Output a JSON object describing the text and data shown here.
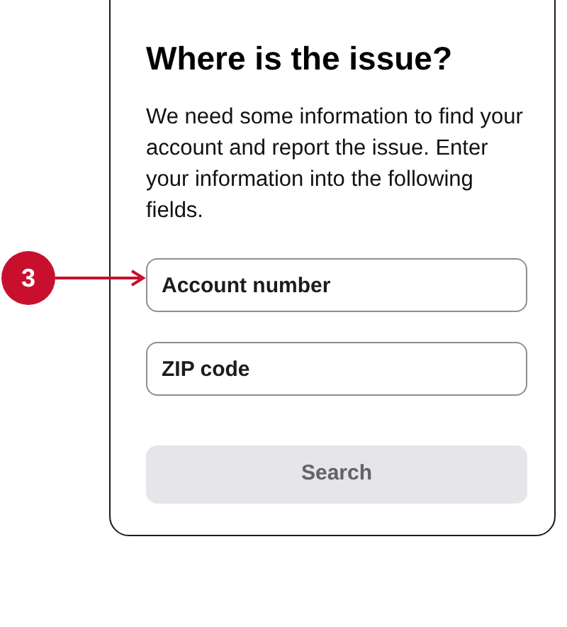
{
  "card": {
    "title": "Where is the issue?",
    "description": "We need some information to find your account and report the issue. Enter your information into the following fields.",
    "fields": [
      {
        "placeholder": "Account number"
      },
      {
        "placeholder": "ZIP code"
      }
    ],
    "button": {
      "label": "Search",
      "disabled": true
    }
  },
  "callout": {
    "number": "3"
  }
}
